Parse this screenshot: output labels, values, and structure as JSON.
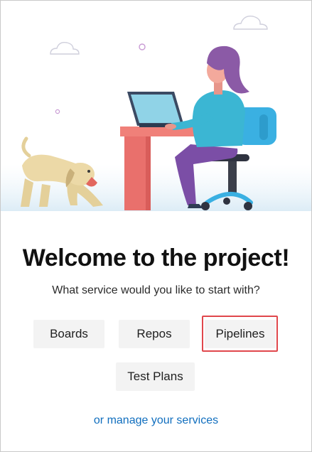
{
  "welcome": {
    "title": "Welcome to the project!",
    "subtitle": "What service would you like to start with?"
  },
  "services": {
    "boards_label": "Boards",
    "repos_label": "Repos",
    "pipelines_label": "Pipelines",
    "test_plans_label": "Test Plans"
  },
  "highlighted_service": "Pipelines",
  "manage_link": "or manage your services",
  "colors": {
    "link": "#106ebe",
    "highlight": "#e0474c",
    "button_bg": "#f3f3f3",
    "desk": "#f08079",
    "shirt": "#3bb6d3",
    "chair": "#3ab0e2",
    "hair": "#8b5aa6",
    "dog": "#ecd9a7"
  }
}
